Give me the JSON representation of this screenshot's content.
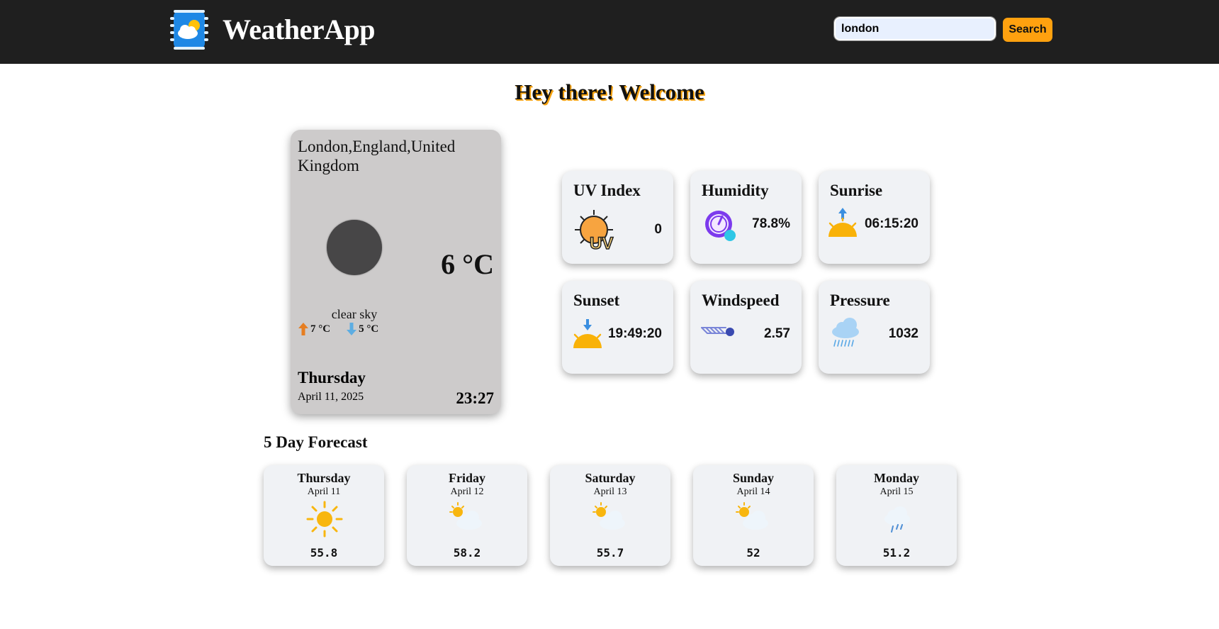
{
  "header": {
    "app_title": "WeatherApp",
    "logo_icon": "weather-cloud-sun-icon",
    "search_value": "london",
    "search_button": "Search"
  },
  "welcome": "Hey there! Welcome",
  "current": {
    "location": "London,England,United Kingdom",
    "temperature": "6 °C",
    "description": "clear sky",
    "high": "7 °C",
    "low": "5 °C",
    "day": "Thursday",
    "date": "April 11, 2025",
    "time": "23:27"
  },
  "stats": {
    "uv": {
      "label": "UV Index",
      "value": "0",
      "icon": "uv-sun-icon"
    },
    "humidity": {
      "label": "Humidity",
      "value": "78.8%",
      "icon": "humidity-gauge-icon"
    },
    "sunrise": {
      "label": "Sunrise",
      "value": "06:15:20",
      "icon": "sunrise-icon"
    },
    "sunset": {
      "label": "Sunset",
      "value": "19:49:20",
      "icon": "sunset-icon"
    },
    "windspeed": {
      "label": "Windspeed",
      "value": "2.57",
      "icon": "wind-icon"
    },
    "pressure": {
      "label": "Pressure",
      "value": "1032",
      "icon": "rain-cloud-icon"
    }
  },
  "forecast": {
    "heading": "5 Day Forecast",
    "days": [
      {
        "day": "Thursday",
        "date": "April 11",
        "temp": "55.8",
        "icon": "sun-icon"
      },
      {
        "day": "Friday",
        "date": "April 12",
        "temp": "58.2",
        "icon": "partly-cloudy-icon"
      },
      {
        "day": "Saturday",
        "date": "April 13",
        "temp": "55.7",
        "icon": "partly-cloudy-icon"
      },
      {
        "day": "Sunday",
        "date": "April 14",
        "temp": "52",
        "icon": "partly-cloudy-icon"
      },
      {
        "day": "Monday",
        "date": "April 15",
        "temp": "51.2",
        "icon": "rain-cloud-icon"
      }
    ]
  },
  "colors": {
    "header_bg": "#1f1f1f",
    "accent": "#ffa10f",
    "card_bg": "#f0f2f5",
    "main_card_bg": "#cdcbcb"
  }
}
